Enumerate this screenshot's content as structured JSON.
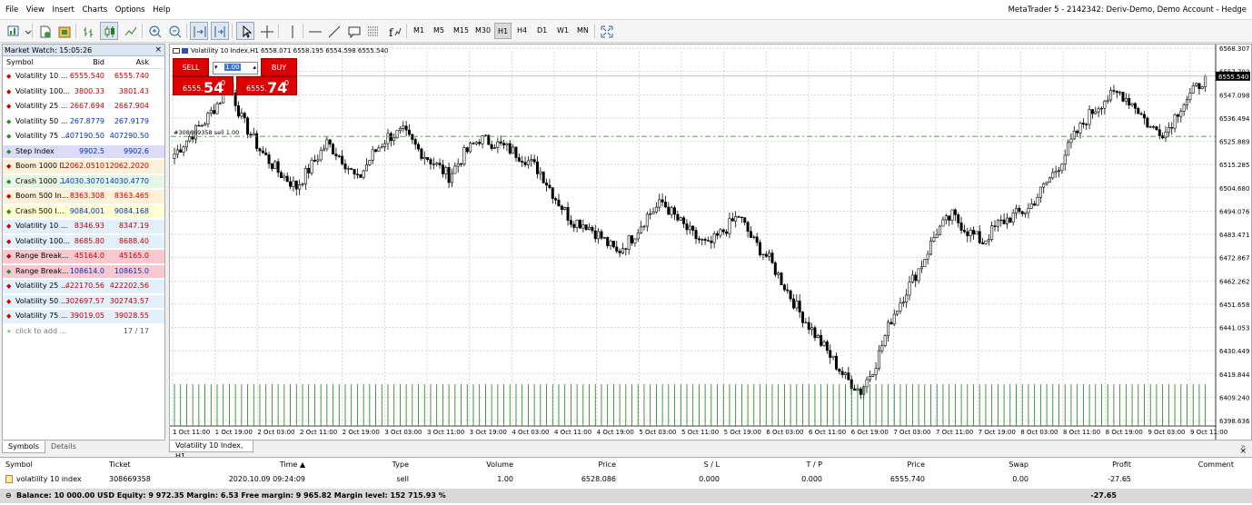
{
  "menu": [
    "File",
    "View",
    "Insert",
    "Charts",
    "Options",
    "Help"
  ],
  "app_title": "MetaTrader 5 - 2142342: Deriv-Demo, Demo Account - Hedge",
  "timeframes": [
    "M1",
    "M5",
    "M15",
    "M30",
    "H1",
    "H4",
    "D1",
    "W1",
    "MN"
  ],
  "active_timeframe": "H1",
  "market_watch": {
    "title": "Market Watch: 15:05:26",
    "close": "×",
    "headers": {
      "symbol": "Symbol",
      "bid": "Bid",
      "ask": "Ask"
    },
    "rows": [
      {
        "symbol": "Volatility 10 ...",
        "bid": "6555.540",
        "ask": "6555.740",
        "dir": "down",
        "color": "#c00000",
        "bg": ""
      },
      {
        "symbol": "Volatility 100...",
        "bid": "3800.33",
        "ask": "3801.43",
        "dir": "down",
        "color": "#c00000",
        "bg": ""
      },
      {
        "symbol": "Volatility 25 ...",
        "bid": "2667.694",
        "ask": "2667.904",
        "dir": "down",
        "color": "#c00000",
        "bg": ""
      },
      {
        "symbol": "Volatility 50 ...",
        "bid": "267.8779",
        "ask": "267.9179",
        "dir": "up",
        "color": "#0030c0",
        "bg": ""
      },
      {
        "symbol": "Volatility 75 ...",
        "bid": "407190.50",
        "ask": "407290.50",
        "dir": "up",
        "color": "#0030c0",
        "bg": ""
      },
      {
        "symbol": "Step Index",
        "bid": "9902.5",
        "ask": "9902.6",
        "dir": "up",
        "color": "#0030c0",
        "bg": "#dcdcf8"
      },
      {
        "symbol": "Boom 1000 I...",
        "bid": "12062.0510",
        "ask": "12062.2020",
        "dir": "down",
        "color": "#c00000",
        "bg": "#fff0d8"
      },
      {
        "symbol": "Crash 1000 ...",
        "bid": "14030.3070",
        "ask": "14030.4770",
        "dir": "up",
        "color": "#0030c0",
        "bg": "#e4f8e4"
      },
      {
        "symbol": "Boom 500 In...",
        "bid": "8363.308",
        "ask": "8363.465",
        "dir": "down",
        "color": "#c00000",
        "bg": "#fff0d8"
      },
      {
        "symbol": "Crash 500 I...",
        "bid": "9084.001",
        "ask": "9084.168",
        "dir": "up",
        "color": "#0030c0",
        "bg": "#ffffd0"
      },
      {
        "symbol": "Volatility 10 ...",
        "bid": "8346.93",
        "ask": "8347.19",
        "dir": "down",
        "color": "#c00000",
        "bg": "#e2f0fb"
      },
      {
        "symbol": "Volatility 100...",
        "bid": "8685.80",
        "ask": "8688.40",
        "dir": "down",
        "color": "#c00000",
        "bg": "#e2f0fb"
      },
      {
        "symbol": "Range Break...",
        "bid": "45164.0",
        "ask": "45165.0",
        "dir": "down",
        "color": "#c00000",
        "bg": "#f8c8d0"
      },
      {
        "symbol": "Range Break...",
        "bid": "108614.0",
        "ask": "108615.0",
        "dir": "up",
        "color": "#0030c0",
        "bg": "#f8c8d0"
      },
      {
        "symbol": "Volatility 25 ...",
        "bid": "422170.56",
        "ask": "422202.56",
        "dir": "down",
        "color": "#c00000",
        "bg": "#e2f0fb"
      },
      {
        "symbol": "Volatility 50 ...",
        "bid": "302697.57",
        "ask": "302743.57",
        "dir": "down",
        "color": "#c00000",
        "bg": "#e2f0fb"
      },
      {
        "symbol": "Volatility 75 ...",
        "bid": "39019.05",
        "ask": "39028.55",
        "dir": "down",
        "color": "#c00000",
        "bg": "#e2f0fb"
      }
    ],
    "add_row": "click to add ...",
    "count": "17 / 17",
    "tabs": [
      "Symbols",
      "Details"
    ]
  },
  "chart": {
    "title_line": "Volatility 10 Index,H1  6558.071 6558.195 6554.598 6555.540",
    "tab": "Volatility 10 Index, H1",
    "position_label": "#308669358 sell 1.00",
    "one_click": {
      "sell": "SELL",
      "buy": "BUY",
      "lot": "1.00",
      "sell_small": "6555.",
      "sell_big": "54",
      "sell_sup": "0",
      "buy_small": "6555.",
      "buy_big": "74",
      "buy_sup": "0"
    },
    "current_price": "6555.540",
    "price_ticks": [
      "6568.307",
      "6557.702",
      "6547.098",
      "6536.494",
      "6525.889",
      "6515.285",
      "6504.680",
      "6494.076",
      "6483.471",
      "6472.867",
      "6462.262",
      "6451.658",
      "6441.053",
      "6430.449",
      "6419.844",
      "6409.240",
      "6398.636"
    ],
    "time_ticks": [
      "1 Oct 11:00",
      "1 Oct 19:00",
      "2 Oct 03:00",
      "2 Oct 11:00",
      "2 Oct 19:00",
      "3 Oct 03:00",
      "3 Oct 11:00",
      "3 Oct 19:00",
      "4 Oct 03:00",
      "4 Oct 11:00",
      "4 Oct 19:00",
      "5 Oct 03:00",
      "5 Oct 11:00",
      "5 Oct 19:00",
      "6 Oct 03:00",
      "6 Oct 11:00",
      "6 Oct 19:00",
      "7 Oct 03:00",
      "7 Oct 11:00",
      "7 Oct 19:00",
      "8 Oct 03:00",
      "8 Oct 11:00",
      "8 Oct 19:00",
      "9 Oct 03:00",
      "9 Oct 11:00"
    ]
  },
  "chart_data": {
    "type": "candlestick",
    "symbol": "Volatility 10 Index",
    "timeframe": "H1",
    "ylim": [
      6398.636,
      6568.307
    ],
    "x_start": "1 Oct 11:00",
    "x_end": "9 Oct 11:00",
    "close_path": [
      [
        0,
        6520
      ],
      [
        5,
        6528
      ],
      [
        10,
        6535
      ],
      [
        15,
        6545
      ],
      [
        18,
        6552
      ],
      [
        22,
        6536
      ],
      [
        28,
        6522
      ],
      [
        34,
        6512
      ],
      [
        40,
        6505
      ],
      [
        45,
        6515
      ],
      [
        50,
        6525
      ],
      [
        55,
        6518
      ],
      [
        60,
        6508
      ],
      [
        65,
        6520
      ],
      [
        70,
        6528
      ],
      [
        75,
        6530
      ],
      [
        80,
        6522
      ],
      [
        85,
        6516
      ],
      [
        90,
        6510
      ],
      [
        95,
        6520
      ],
      [
        100,
        6527
      ],
      [
        105,
        6525
      ],
      [
        110,
        6522
      ],
      [
        115,
        6518
      ],
      [
        120,
        6512
      ],
      [
        125,
        6500
      ],
      [
        130,
        6490
      ],
      [
        135,
        6488
      ],
      [
        140,
        6482
      ],
      [
        145,
        6475
      ],
      [
        150,
        6482
      ],
      [
        155,
        6492
      ],
      [
        160,
        6498
      ],
      [
        165,
        6490
      ],
      [
        170,
        6483
      ],
      [
        175,
        6478
      ],
      [
        180,
        6485
      ],
      [
        185,
        6492
      ],
      [
        190,
        6480
      ],
      [
        195,
        6472
      ],
      [
        200,
        6460
      ],
      [
        205,
        6448
      ],
      [
        210,
        6438
      ],
      [
        215,
        6428
      ],
      [
        220,
        6418
      ],
      [
        225,
        6412
      ],
      [
        230,
        6425
      ],
      [
        235,
        6445
      ],
      [
        240,
        6458
      ],
      [
        245,
        6470
      ],
      [
        250,
        6485
      ],
      [
        255,
        6492
      ],
      [
        260,
        6485
      ],
      [
        265,
        6480
      ],
      [
        270,
        6488
      ],
      [
        275,
        6492
      ],
      [
        280,
        6495
      ],
      [
        285,
        6505
      ],
      [
        290,
        6515
      ],
      [
        295,
        6528
      ],
      [
        300,
        6538
      ],
      [
        305,
        6545
      ],
      [
        310,
        6548
      ],
      [
        315,
        6542
      ],
      [
        320,
        6532
      ],
      [
        325,
        6530
      ],
      [
        330,
        6542
      ],
      [
        335,
        6550
      ],
      [
        338,
        6555.54
      ]
    ],
    "volume": "tick volume histogram along bottom"
  },
  "trade": {
    "headers": [
      "Symbol",
      "Ticket",
      "Time",
      "Type",
      "Volume",
      "Price",
      "S / L",
      "T / P",
      "Price",
      "Swap",
      "Profit",
      "Comment"
    ],
    "row": [
      "volatility 10 index",
      "308669358",
      "2020.10.09 09:24:09",
      "sell",
      "1.00",
      "6528.086",
      "0.000",
      "0.000",
      "6555.740",
      "0.00",
      "-27.65",
      ""
    ],
    "balance": "Balance: 10 000.00 USD  Equity: 9 972.35  Margin: 6.53  Free margin: 9 965.82  Margin level: 152 715.93 %",
    "balance_profit": "-27.65",
    "row_close": "×",
    "panel_close": "×"
  }
}
